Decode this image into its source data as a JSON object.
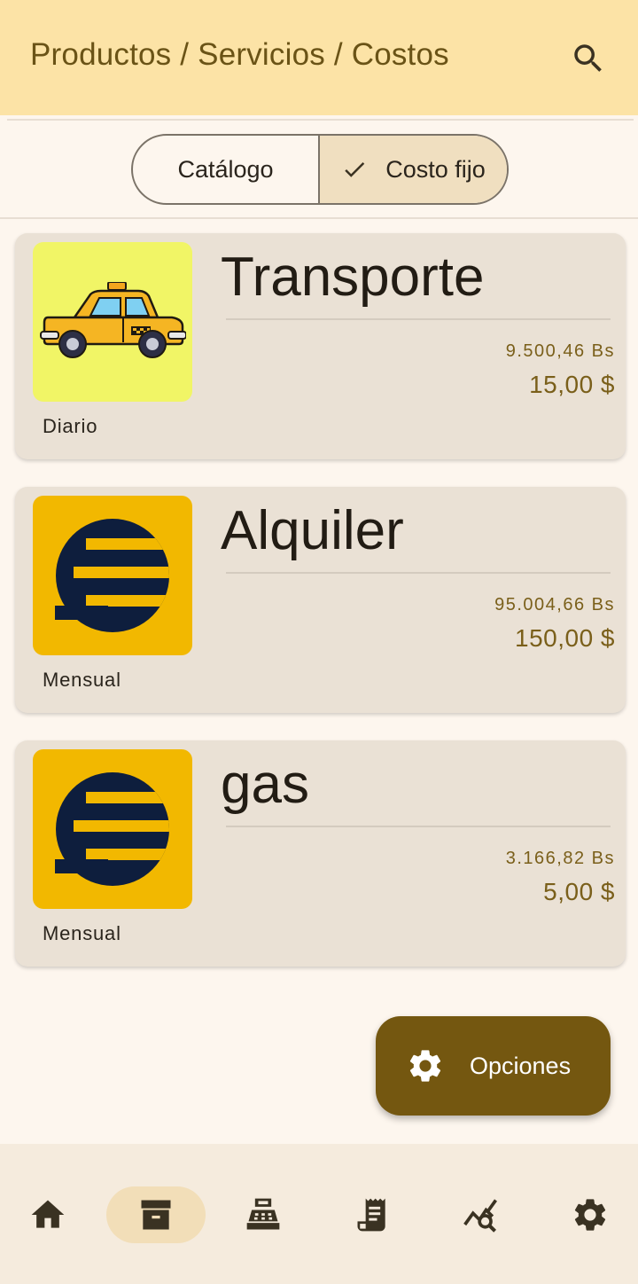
{
  "app_bar": {
    "title": "Productos / Servicios / Costos",
    "search_icon": "search-icon"
  },
  "segmented": {
    "left_label": "Catálogo",
    "right_label": "Costo fijo",
    "selected": "Costo fijo"
  },
  "items": [
    {
      "name": "Transporte",
      "frequency": "Diario",
      "amount_bs": "9.500,46 Bs",
      "amount_usd": "15,00 $",
      "image": "taxi-image"
    },
    {
      "name": "Alquiler",
      "frequency": "Mensual",
      "amount_bs": "95.004,66 Bs",
      "amount_usd": "150,00 $",
      "image": "company-logo-image"
    },
    {
      "name": "gas",
      "frequency": "Mensual",
      "amount_bs": "3.166,82 Bs",
      "amount_usd": "5,00 $",
      "image": "company-logo-image"
    }
  ],
  "fab": {
    "label": "Opciones",
    "icon": "gear-icon"
  },
  "bottom_nav": {
    "items": [
      "home-icon",
      "archive-icon",
      "cash-register-icon",
      "receipt-icon",
      "analytics-search-icon",
      "settings-icon"
    ],
    "active_index": 1
  },
  "colors": {
    "app_bar_bg": "#FCE3A6",
    "title_color": "#6A5316",
    "card_bg": "#EAE1D5",
    "amount_color": "#7A5F1A",
    "fab_bg": "#745710",
    "segment_selected_bg": "#F0DFC0",
    "nav_active_bg": "#F2DEB8"
  }
}
